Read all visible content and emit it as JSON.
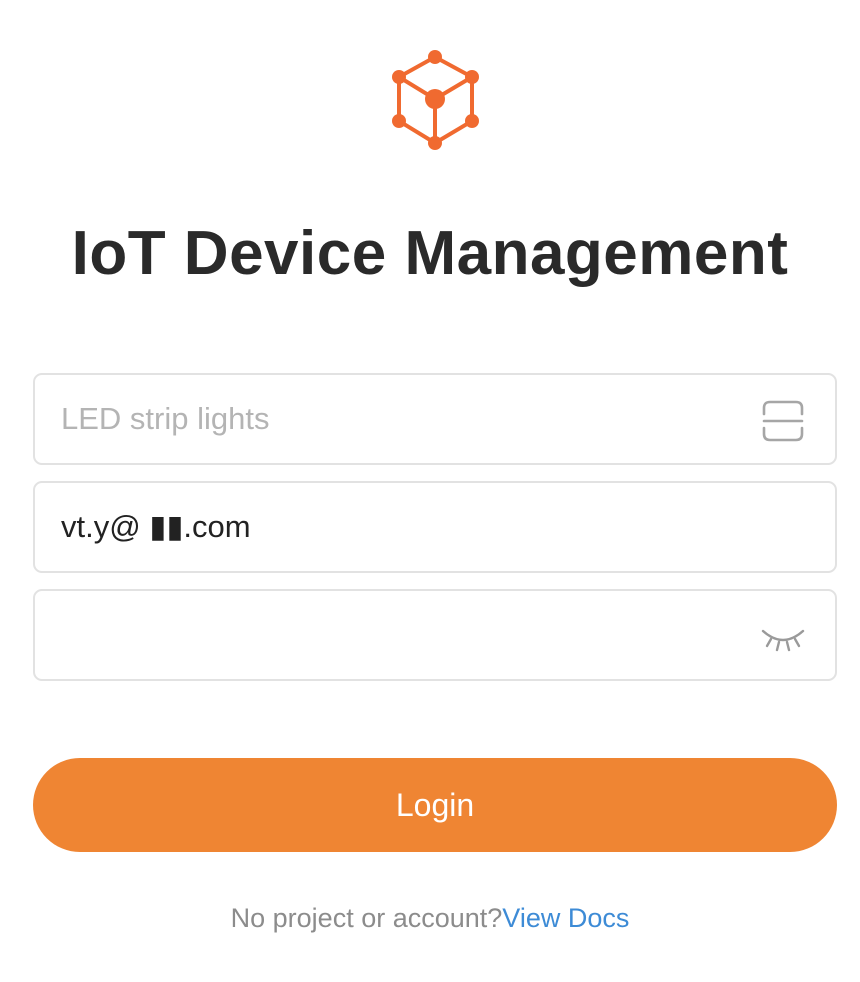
{
  "header": {
    "logo_icon": "cube-network-icon",
    "title": "IoT Device Management"
  },
  "form": {
    "project": {
      "placeholder": "LED strip lights",
      "value": "",
      "icon": "scan-icon"
    },
    "email": {
      "value": "vt.y@ ▮▮.com"
    },
    "password": {
      "value": "",
      "icon": "eye-closed-icon"
    },
    "login_label": "Login"
  },
  "footer": {
    "hint": "No project or account?",
    "link_label": "View Docs"
  },
  "colors": {
    "accent": "#ef8533",
    "link": "#3d8bd6",
    "logo": "#f06a30"
  }
}
